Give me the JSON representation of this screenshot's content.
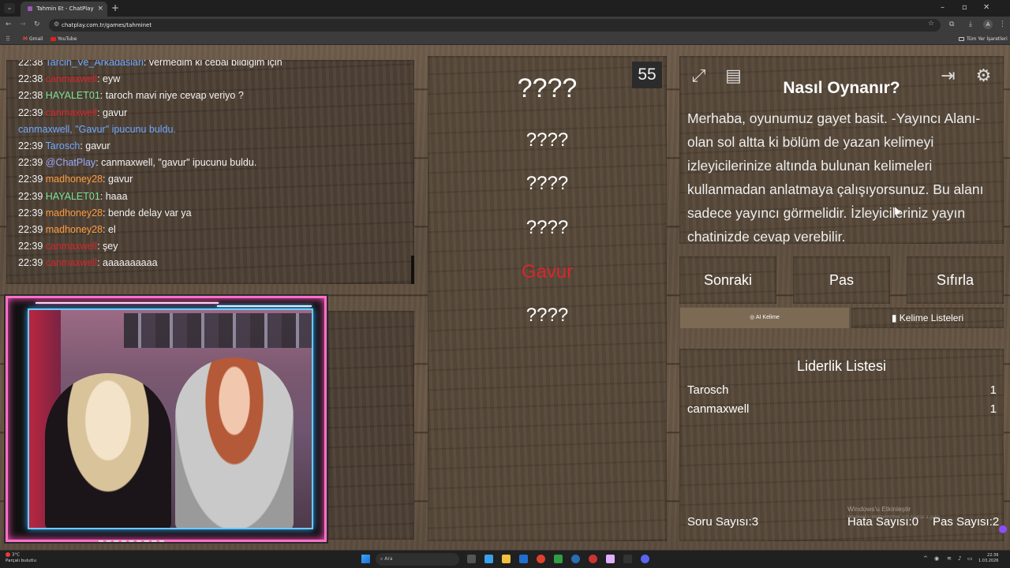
{
  "browser": {
    "tab_title": "Tahmin Et - ChatPlay",
    "url": "chatplay.com.tr/games/tahminet",
    "account_initial": "A",
    "bookmarks": [
      {
        "label": "Gmail",
        "icon": "gmail-icon"
      },
      {
        "label": "YouTube",
        "icon": "youtube-icon"
      }
    ],
    "all_bookmarks_label": "Tüm Yer İşaretleri"
  },
  "chat": {
    "messages": [
      {
        "time": "22:38",
        "user": "Tarcin_Ve_Arkadaslari",
        "color": "#6fa8ff",
        "text": ": vermedim ki cebai bildigim için"
      },
      {
        "time": "22:38",
        "user": "canmaxwell",
        "color": "#d9262c",
        "text": ": eyw"
      },
      {
        "time": "22:38",
        "user": "HAYALET01",
        "color": "#7be495",
        "text": ": taroch mavi niye cevap veriyo ?"
      },
      {
        "time": "22:39",
        "user": "canmaxwell",
        "color": "#d9262c",
        "text": ": gavur"
      },
      {
        "time": "",
        "user": "canmaxwell, \"Gavur\" ipucunu buldu.",
        "color": "#6fa8ff",
        "text": "",
        "system": true
      },
      {
        "time": "22:39",
        "user": "Tarosch",
        "color": "#6fa8ff",
        "text": ": gavur"
      },
      {
        "time": "22:39",
        "user": "@ChatPlay",
        "color": "#9aa8ff",
        "text": ": canmaxwell, \"gavur\" ipucunu buldu."
      },
      {
        "time": "22:39",
        "user": "madhoney28",
        "color": "#ff9b3d",
        "text": ": gavur"
      },
      {
        "time": "22:39",
        "user": "HAYALET01",
        "color": "#7be495",
        "text": ": haaa"
      },
      {
        "time": "22:39",
        "user": "madhoney28",
        "color": "#ff9b3d",
        "text": ": bende delay var ya"
      },
      {
        "time": "22:39",
        "user": "madhoney28",
        "color": "#ff9b3d",
        "text": ": el"
      },
      {
        "time": "22:39",
        "user": "canmaxwell",
        "color": "#d9262c",
        "text": ": şey"
      },
      {
        "time": "22:39",
        "user": "canmaxwell",
        "color": "#d9262c",
        "text": ": aaaaaaaaaa"
      }
    ]
  },
  "game": {
    "counter": "55",
    "words": [
      {
        "text": "????",
        "state": "hidden",
        "size": "big"
      },
      {
        "text": "????",
        "state": "hidden",
        "size": "small"
      },
      {
        "text": "????",
        "state": "hidden",
        "size": "small"
      },
      {
        "text": "????",
        "state": "hidden",
        "size": "small"
      },
      {
        "text": "Gavur",
        "state": "revealed",
        "size": "small"
      },
      {
        "text": "????",
        "state": "hidden",
        "size": "small"
      }
    ],
    "colors": {
      "revealed": "#d9262c",
      "hidden": "#ffffff"
    }
  },
  "howto": {
    "title": "Nasıl Oynanır?",
    "text": "Merhaba, oyunumuz gayet basit. -Yayıncı Alanı- olan sol altta ki bölüm de yazan kelimeyi izleyicilerinize altında bulunan kelimeleri kullanmadan anlatmaya çalışıyorsunuz. Bu alanı sadece yayıncı görmelidir. İzleyicileriniz yayın chatinizde cevap verebilir."
  },
  "actions": {
    "next": "Sonraki",
    "pass": "Pas",
    "reset": "Sıfırla",
    "ai_words": "AI Kelime",
    "word_lists": "Kelime Listeleri"
  },
  "leaderboard": {
    "title": "Liderlik Listesi",
    "rows": [
      {
        "name": "Tarosch",
        "score": "1"
      },
      {
        "name": "canmaxwell",
        "score": "1"
      }
    ]
  },
  "stats": {
    "questions": "Soru Sayısı:3",
    "errors": "Hata Sayısı:0",
    "passes": "Pas Sayısı:2"
  },
  "watermark": {
    "line1": "Windows'u Etkinleştir",
    "line2": "Windows'u etkinleştirmek için Ayarlar'a gidin."
  },
  "taskbar": {
    "weather_temp": "3°C",
    "weather_desc": "Parçalı bulutlu",
    "search_placeholder": "Ara",
    "time": "22:39",
    "date": "1.03.2026"
  }
}
